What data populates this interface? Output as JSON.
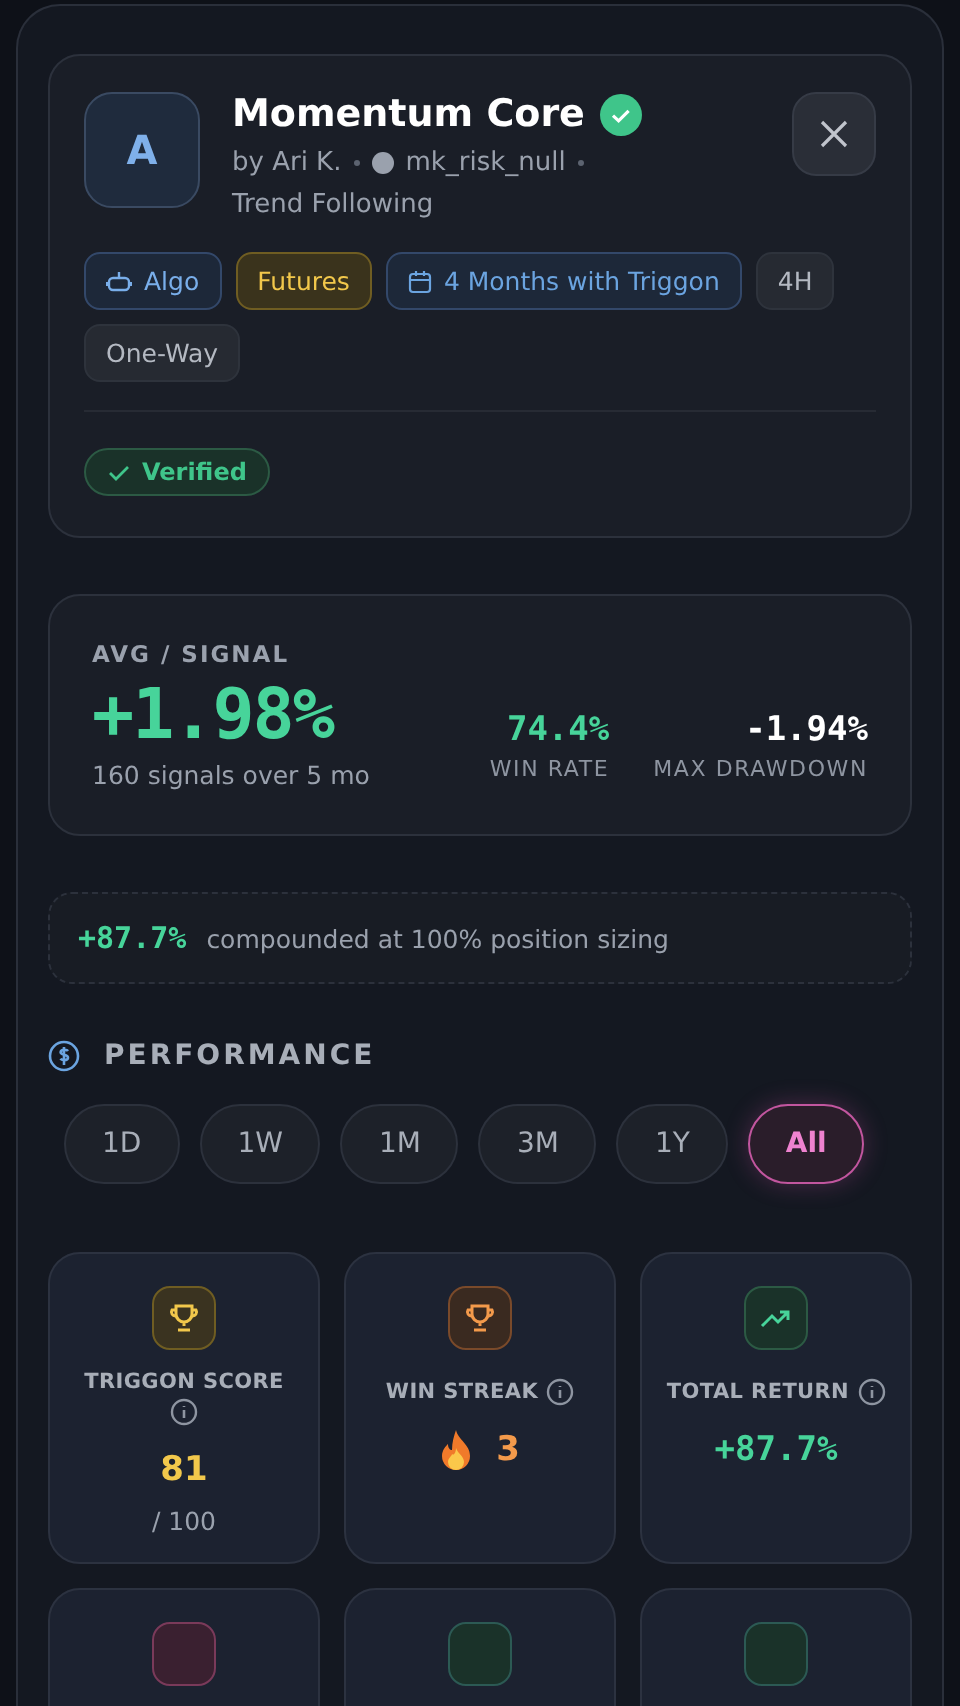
{
  "header": {
    "avatar_letter": "A",
    "title": "Momentum Core",
    "verified_badge": true,
    "author": "by Ari K.",
    "handle": "mk_risk_null",
    "category": "Trend Following",
    "tags": [
      {
        "kind": "algo",
        "label": "Algo"
      },
      {
        "kind": "futures",
        "label": "Futures"
      },
      {
        "kind": "tenure",
        "label": "4 Months with Triggon"
      },
      {
        "kind": "plain",
        "label": "4H"
      },
      {
        "kind": "plain",
        "label": "One-Way"
      }
    ],
    "status": "Verified"
  },
  "summary": {
    "label": "AVG / SIGNAL",
    "value": "+1.98%",
    "note": "160 signals over 5 mo",
    "metrics": [
      {
        "kind": "positive",
        "value": "74.4%",
        "label": "WIN RATE"
      },
      {
        "kind": "neutral",
        "value": "-1.94%",
        "label": "MAX DRAWDOWN"
      }
    ]
  },
  "compounded": {
    "value": "+87.7%",
    "text": "compounded at 100% position sizing"
  },
  "performance": {
    "title": "PERFORMANCE",
    "periods": [
      {
        "label": "1D",
        "selected": false
      },
      {
        "label": "1W",
        "selected": false
      },
      {
        "label": "1M",
        "selected": false
      },
      {
        "label": "3M",
        "selected": false
      },
      {
        "label": "1Y",
        "selected": false
      },
      {
        "label": "All",
        "selected": true
      }
    ],
    "tiles": [
      {
        "kind": "score",
        "label": "TRIGGON SCORE",
        "value": "81",
        "sub": "/ 100"
      },
      {
        "kind": "streak",
        "label": "WIN STREAK",
        "value": "3"
      },
      {
        "kind": "return",
        "label": "TOTAL RETURN",
        "value": "+87.7%"
      }
    ],
    "more_tiles": [
      {
        "kind": "pink"
      },
      {
        "kind": "teal"
      },
      {
        "kind": "teal"
      }
    ]
  }
}
